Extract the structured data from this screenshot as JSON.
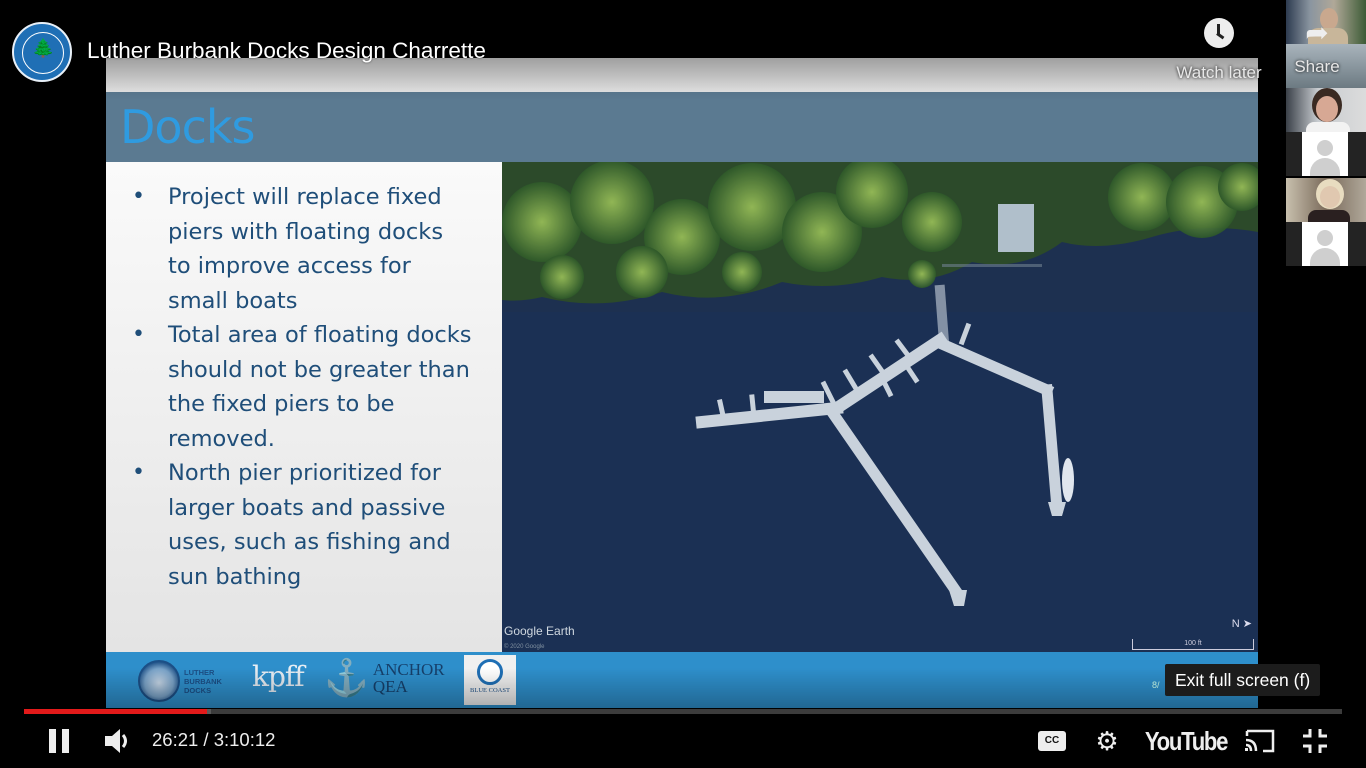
{
  "video": {
    "title": "Luther Burbank Docks Design Charrette",
    "channel_logo": "city-of-mercer-island-washington-seal"
  },
  "top_actions": {
    "watch_later": {
      "label": "Watch later",
      "icon": "clock-icon"
    },
    "share": {
      "label": "Share",
      "icon": "share-arrow-icon"
    }
  },
  "slide": {
    "title": "Docks",
    "bullets": [
      "Project will replace fixed piers with floating docks to improve access for small boats",
      "Total area of floating docks should not be greater than the fixed piers to be removed.",
      "North pier prioritized for larger boats and passive uses, such as fishing and sun bathing"
    ],
    "photo": {
      "attribution": "Google Earth",
      "copyright": "© 2020 Google",
      "scale_label": "100 ft",
      "north_indicator": "N ➤"
    },
    "footer_logos": [
      {
        "name": "Luther Burbank Docks",
        "text": "LUTHER\nBURBANK\nDOCKS"
      },
      {
        "name": "kpff",
        "text": "kpff"
      },
      {
        "name": "Anchor QEA",
        "text": "ANCHOR\nQEA"
      },
      {
        "name": "Blue Coast Engineering",
        "text": "BLUE COAST"
      }
    ],
    "date_partial": "8/"
  },
  "participants": [
    {
      "type": "camera"
    },
    {
      "type": "camera"
    },
    {
      "type": "camera"
    },
    {
      "type": "avatar"
    },
    {
      "type": "camera"
    },
    {
      "type": "avatar"
    }
  ],
  "tooltip": {
    "text": "Exit full screen (f)"
  },
  "player": {
    "current_time": "26:21",
    "duration": "3:10:12",
    "time_display": "26:21 / 3:10:12",
    "played_fraction": 0.1387,
    "loaded_fraction": 0.142,
    "brand": "YouTube",
    "cc_label": "CC",
    "accent_color": "#e21a1a"
  }
}
